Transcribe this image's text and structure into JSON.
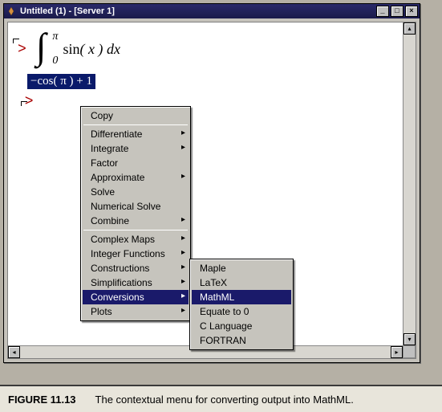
{
  "window": {
    "title": "Untitled (1) - [Server 1]"
  },
  "math": {
    "upper_bound": "π",
    "lower_bound": "0",
    "expression_fn": "sin",
    "expression_arg": "( x )",
    "expression_dx": " dx",
    "output": "−cos( π ) + 1"
  },
  "menu": {
    "copy": "Copy",
    "differentiate": "Differentiate",
    "integrate": "Integrate",
    "factor": "Factor",
    "approximate": "Approximate",
    "solve": "Solve",
    "numerical_solve": "Numerical Solve",
    "combine": "Combine",
    "complex_maps": "Complex Maps",
    "integer_functions": "Integer Functions",
    "constructions": "Constructions",
    "simplifications": "Simplifications",
    "conversions": "Conversions",
    "plots": "Plots"
  },
  "submenu": {
    "maple": "Maple",
    "latex": "LaTeX",
    "mathml": "MathML",
    "equate0": "Equate to 0",
    "clang": "C Language",
    "fortran": "FORTRAN"
  },
  "caption": {
    "label": "FIGURE 11.13",
    "text": "The contextual menu for converting output into MathML."
  }
}
